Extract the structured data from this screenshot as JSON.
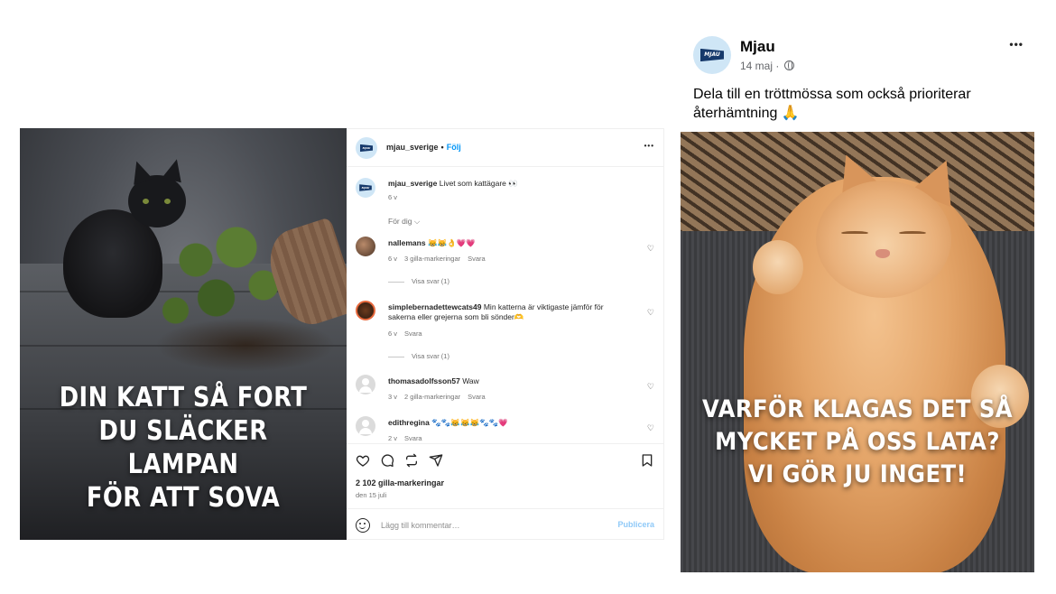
{
  "instagram": {
    "account": "mjau_sverige",
    "avatar_label": "MJAU",
    "follow_label": "Följ",
    "more_label": "•••",
    "image_text": [
      "DIN KATT SÅ FORT",
      "DU SLÄCKER LAMPAN",
      "FÖR ATT SOVA"
    ],
    "caption": {
      "user": "mjau_sverige",
      "text": "Livet som kattägare 👀",
      "time": "6 v"
    },
    "for_you_label": "För dig ⌵",
    "comments": [
      {
        "user": "nallemans",
        "text": "😹😹👌💗💗",
        "time": "6 v",
        "likes": "3 gilla-markeringar",
        "reply": "Svara",
        "view_replies": "Visa svar (1)"
      },
      {
        "user": "simplebernadettewcats49",
        "text": "Min katterna är viktigaste jämför för sakerna eller grejerna som bli sönder🫶",
        "time": "6 v",
        "likes": "",
        "reply": "Svara",
        "view_replies": "Visa svar (1)"
      },
      {
        "user": "thomasadolfsson57",
        "text": "Waw",
        "time": "3 v",
        "likes": "2 gilla-markeringar",
        "reply": "Svara",
        "view_replies": ""
      },
      {
        "user": "edithregina",
        "text": "🐾🐾😹😹😹🐾🐾💗",
        "time": "2 v",
        "likes": "",
        "reply": "Svara",
        "view_replies": ""
      }
    ],
    "likes_count": "2 102 gilla-markeringar",
    "date": "den 15 juli",
    "add_comment_placeholder": "Lägg till kommentar…",
    "publish_label": "Publicera"
  },
  "facebook": {
    "page_name": "Mjau",
    "avatar_label": "MJAU",
    "post_time": "14 maj",
    "separator": "·",
    "more_label": "•••",
    "caption": "Dela till en tröttmössa som också prioriterar återhämtning 🙏",
    "image_text": [
      "VARFÖR KLAGAS DET SÅ",
      "MYCKET PÅ OSS LATA?",
      "VI GÖR JU INGET!"
    ]
  },
  "icons": [
    "heart-icon",
    "comment-icon",
    "share-icon",
    "send-icon",
    "bookmark-icon",
    "emoji-icon",
    "globe-icon",
    "more-icon"
  ],
  "colors": {
    "ig_link": "#0095f6",
    "ig_publish": "#8fc9f8",
    "mjau_flag": "#16396b",
    "mjau_avatar_bg": "#cfe6f6"
  }
}
